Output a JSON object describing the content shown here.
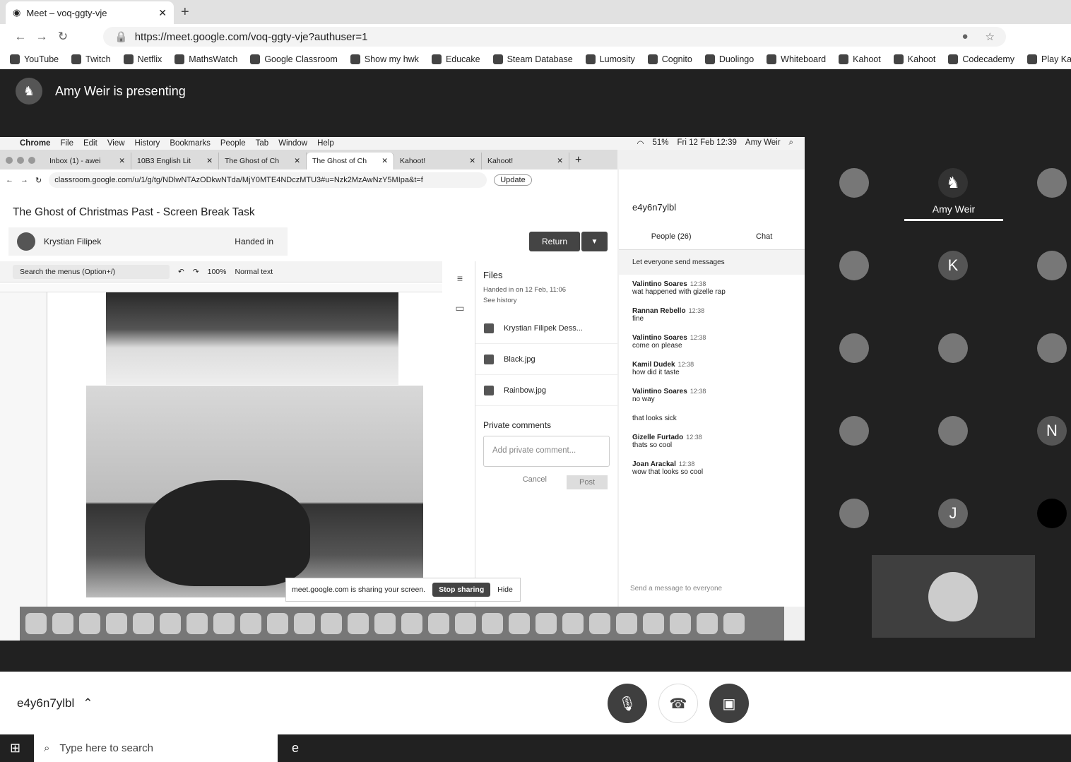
{
  "browser": {
    "tab_title": "Meet – voq-ggty-vje",
    "url": "https://meet.google.com/voq-ggty-vje?authuser=1",
    "bookmarks": [
      "YouTube",
      "Twitch",
      "Netflix",
      "MathsWatch",
      "Google Classroom",
      "Show my hwk",
      "Educake",
      "Steam Database",
      "Lumosity",
      "Cognito",
      "Duolingo",
      "Whiteboard",
      "Kahoot",
      "Kahoot",
      "Codecademy",
      "Play Kahoot"
    ]
  },
  "meet": {
    "presenting": "Amy Weir is presenting",
    "meeting_code": "e4y6n7ylbl",
    "presenter_tile_name": "Amy Weir",
    "tile_letters": [
      "K",
      "N",
      "J"
    ]
  },
  "mac": {
    "menu": [
      "Chrome",
      "File",
      "Edit",
      "View",
      "History",
      "Bookmarks",
      "People",
      "Tab",
      "Window",
      "Help"
    ],
    "status": "51%",
    "clock": "Fri 12 Feb 12:39",
    "user": "Amy Weir"
  },
  "inner_tabs": [
    "Inbox (1) - awei",
    "10B3 English Lit",
    "The Ghost of Ch",
    "The Ghost of Ch",
    "Kahoot!",
    "Kahoot!"
  ],
  "inner_url": "classroom.google.com/u/1/g/tg/NDlwNTAzODkwNTda/MjY0MTE4NDczMTU3#u=Nzk2MzAwNzY5MIpa&t=f",
  "update": "Update",
  "classroom": {
    "title": "The Ghost of Christmas Past - Screen Break Task",
    "student": "Krystian Filipek",
    "status": "Handed in",
    "return": "Return",
    "docs_search": "Search the menus (Option+/)",
    "zoom": "100%",
    "style": "Normal text",
    "files_title": "Files",
    "handed_in": "Handed in on 12 Feb, 11:06",
    "history": "See history",
    "files": [
      "Krystian Filipek Dess...",
      "Black.jpg",
      "Rainbow.jpg"
    ],
    "private_title": "Private comments",
    "private_placeholder": "Add private comment...",
    "cancel": "Cancel",
    "post": "Post",
    "sharing": "meet.google.com is sharing your screen.",
    "stop": "Stop sharing",
    "hide": "Hide"
  },
  "panel": {
    "code": "e4y6n7ylbl",
    "people": "People (26)",
    "chat": "Chat",
    "let_everyone": "Let everyone send messages",
    "send_placeholder": "Send a message to everyone",
    "messages": [
      {
        "name": "Valintino Soares",
        "time": "12:38",
        "text": "wat happened with gizelle rap"
      },
      {
        "name": "Rannan Rebello",
        "time": "12:38",
        "text": "fine"
      },
      {
        "name": "Valintino Soares",
        "time": "12:38",
        "text": "come on please"
      },
      {
        "name": "Kamil Dudek",
        "time": "12:38",
        "text": "how did it taste"
      },
      {
        "name": "Valintino Soares",
        "time": "12:38",
        "text": "no way"
      },
      {
        "name": "",
        "time": "",
        "text": "that looks sick"
      },
      {
        "name": "Gizelle Furtado",
        "time": "12:38",
        "text": "thats so cool"
      },
      {
        "name": "Joan Arackal",
        "time": "12:38",
        "text": "wow that looks so cool"
      }
    ]
  },
  "taskbar": {
    "search": "Type here to search"
  }
}
